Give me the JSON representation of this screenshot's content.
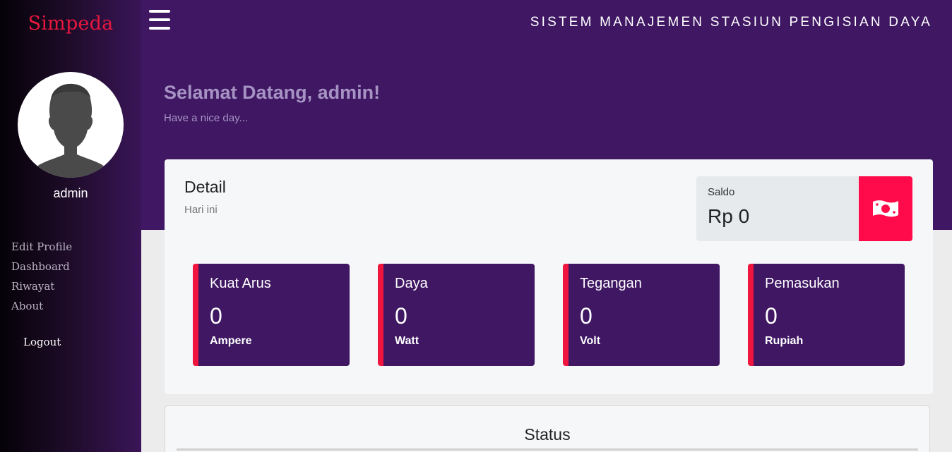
{
  "sidebar": {
    "brand": "Simpeda",
    "username": "admin",
    "items": [
      {
        "label": "Edit Profile"
      },
      {
        "label": "Dashboard"
      },
      {
        "label": "Riwayat"
      },
      {
        "label": "About"
      }
    ],
    "logout_label": "Logout"
  },
  "header": {
    "menu_icon": "hamburger-icon",
    "title": "SISTEM MANAJEMEN STASIUN PENGISIAN DAYA",
    "welcome": "Selamat Datang, admin!",
    "subtitle": "Have a nice day..."
  },
  "detail": {
    "title": "Detail",
    "subtitle": "Hari ini",
    "saldo": {
      "label": "Saldo",
      "value": "Rp 0",
      "icon": "money-bill-icon",
      "accent_color": "#ff0a4a"
    },
    "stats": [
      {
        "title": "Kuat Arus",
        "value": "0",
        "unit": "Ampere"
      },
      {
        "title": "Daya",
        "value": "0",
        "unit": "Watt"
      },
      {
        "title": "Tegangan",
        "value": "0",
        "unit": "Volt"
      },
      {
        "title": "Pemasukan",
        "value": "0",
        "unit": "Rupiah"
      }
    ]
  },
  "status": {
    "title": "Status"
  },
  "colors": {
    "primary": "#3f1763",
    "accent": "#f0153f",
    "brand": "#e8173e"
  }
}
